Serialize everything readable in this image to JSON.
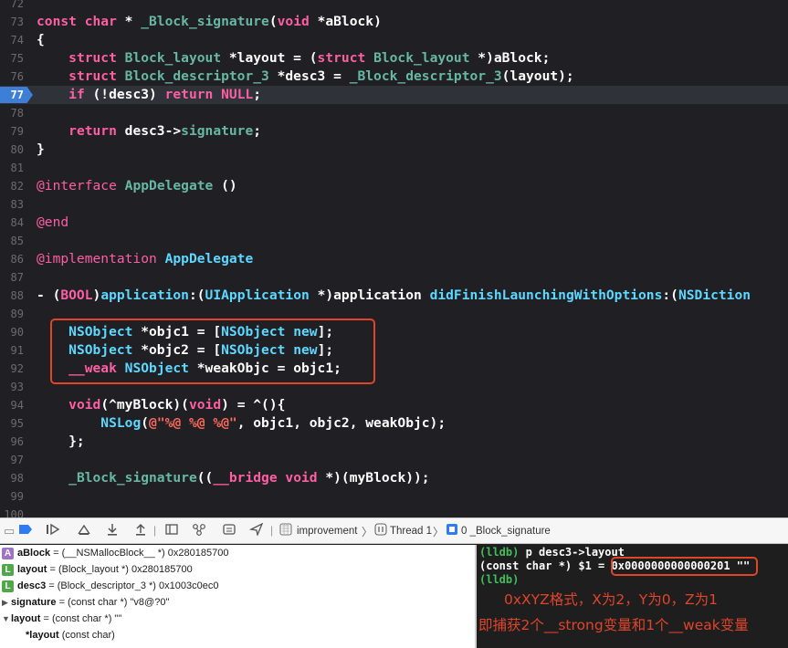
{
  "editor": {
    "current_line": "77",
    "lines": [
      {
        "no": "72",
        "code": ""
      },
      {
        "no": "73",
        "code": "const char * _Block_signature(void *aBlock)"
      },
      {
        "no": "74",
        "code": "{"
      },
      {
        "no": "75",
        "code": "    struct Block_layout *layout = (struct Block_layout *)aBlock;"
      },
      {
        "no": "76",
        "code": "    struct Block_descriptor_3 *desc3 = _Block_descriptor_3(layout);"
      },
      {
        "no": "77",
        "code": "    if (!desc3) return NULL;"
      },
      {
        "no": "78",
        "code": ""
      },
      {
        "no": "79",
        "code": "    return desc3->signature;"
      },
      {
        "no": "80",
        "code": "}"
      },
      {
        "no": "81",
        "code": ""
      },
      {
        "no": "82",
        "code": "@interface AppDelegate ()"
      },
      {
        "no": "83",
        "code": ""
      },
      {
        "no": "84",
        "code": "@end"
      },
      {
        "no": "85",
        "code": ""
      },
      {
        "no": "86",
        "code": "@implementation AppDelegate"
      },
      {
        "no": "87",
        "code": ""
      },
      {
        "no": "88",
        "code": "- (BOOL)application:(UIApplication *)application didFinishLaunchingWithOptions:(NSDiction"
      },
      {
        "no": "89",
        "code": ""
      },
      {
        "no": "90",
        "code": "    NSObject *objc1 = [NSObject new];"
      },
      {
        "no": "91",
        "code": "    NSObject *objc2 = [NSObject new];"
      },
      {
        "no": "92",
        "code": "    __weak NSObject *weakObjc = objc1;"
      },
      {
        "no": "93",
        "code": ""
      },
      {
        "no": "94",
        "code": "    void(^myBlock)(void) = ^(){"
      },
      {
        "no": "95",
        "code": "        NSLog(@\"%@ %@ %@\", objc1, objc2, weakObjc);"
      },
      {
        "no": "96",
        "code": "    };"
      },
      {
        "no": "97",
        "code": ""
      },
      {
        "no": "98",
        "code": "    _Block_signature((__bridge void *)(myBlock));"
      },
      {
        "no": "99",
        "code": ""
      },
      {
        "no": "100",
        "code": ""
      }
    ]
  },
  "toolbar": {
    "breadcrumb": {
      "app": "improvement",
      "thread": "Thread 1",
      "frame": "0 _Block_signature"
    }
  },
  "variables": [
    {
      "badge": "A",
      "kind": "arg",
      "name": "aBlock",
      "value": " = (__NSMallocBlock__ *) 0x280185700",
      "indent": 0,
      "tri": ""
    },
    {
      "badge": "L",
      "kind": "loc",
      "name": "layout",
      "value": " = (Block_layout *) 0x280185700",
      "indent": 0,
      "tri": ""
    },
    {
      "badge": "L",
      "kind": "loc",
      "name": "desc3",
      "value": " = (Block_descriptor_3 *) 0x1003c0ec0",
      "indent": 0,
      "tri": ""
    },
    {
      "badge": "",
      "kind": "",
      "name": "signature",
      "value": " = (const char *) \"v8@?0\"",
      "indent": 0,
      "tri": "▶"
    },
    {
      "badge": "",
      "kind": "",
      "name": "layout",
      "value": " = (const char *) \"\"",
      "indent": 0,
      "tri": "▼"
    },
    {
      "badge": "",
      "kind": "",
      "name": "*layout",
      "value": " (const char)",
      "indent": 1,
      "tri": ""
    }
  ],
  "console": {
    "prompt": "(lldb)",
    "command": " p desc3->layout",
    "result_prefix": "(const char *) $1 = ",
    "result_value": "0x0000000000000201 \"\"",
    "annotation_1": "0xXYZ格式，X为2，Y为0，Z为1",
    "annotation_2": "即捕获2个__strong变量和1个__weak变量"
  },
  "colors": {
    "keyword": "#fc5fa3",
    "type": "#d0a8ff",
    "highlight": "#e0442b",
    "breakpoint": "#3d7fd6"
  }
}
